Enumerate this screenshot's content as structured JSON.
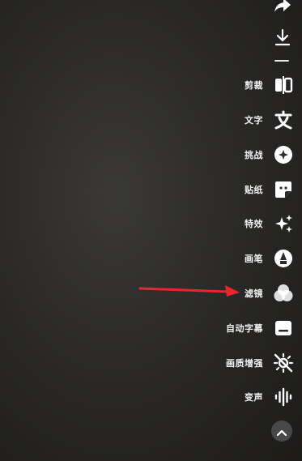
{
  "toolbar": {
    "items": [
      {
        "label": "剪裁",
        "icon": "crop-icon"
      },
      {
        "label": "文字",
        "icon": "text-icon"
      },
      {
        "label": "挑战",
        "icon": "challenge-icon"
      },
      {
        "label": "贴纸",
        "icon": "sticker-icon"
      },
      {
        "label": "特效",
        "icon": "effects-icon"
      },
      {
        "label": "画笔",
        "icon": "brush-icon"
      },
      {
        "label": "滤镜",
        "icon": "filter-icon"
      },
      {
        "label": "自动字幕",
        "icon": "auto-subtitle-icon"
      },
      {
        "label": "画质增强",
        "icon": "quality-enhance-icon"
      },
      {
        "label": "变声",
        "icon": "voice-change-icon"
      }
    ]
  },
  "top_actions": {
    "share_icon": "share-icon",
    "download_icon": "download-icon"
  },
  "collapse_icon": "chevron-up-icon",
  "annotation": {
    "color": "#e8262b"
  }
}
